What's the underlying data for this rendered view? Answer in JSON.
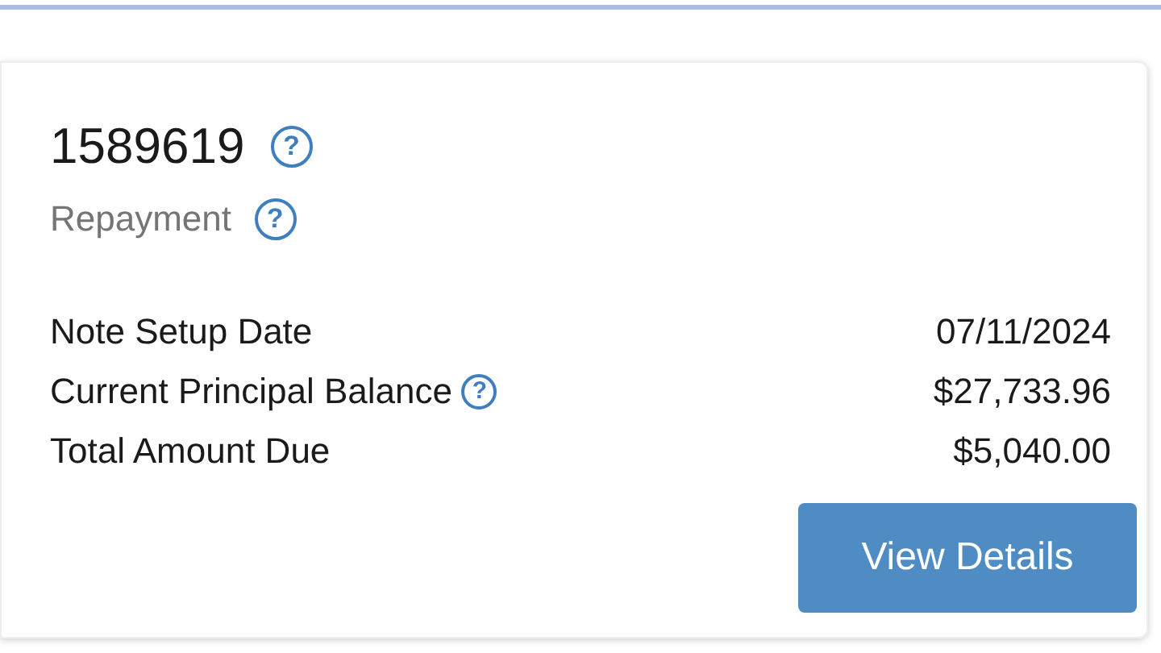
{
  "card": {
    "title": {
      "text": "1589619",
      "help": "?"
    },
    "subtitle": {
      "text": "Repayment",
      "help": "?"
    },
    "rows": [
      {
        "label": "Note Setup Date",
        "value": "07/11/2024"
      },
      {
        "label": "Current Principal Balance",
        "value": "$27,733.96",
        "help": "?"
      },
      {
        "label": "Total Amount Due",
        "value": "$5,040.00"
      }
    ],
    "button": "View Details"
  }
}
